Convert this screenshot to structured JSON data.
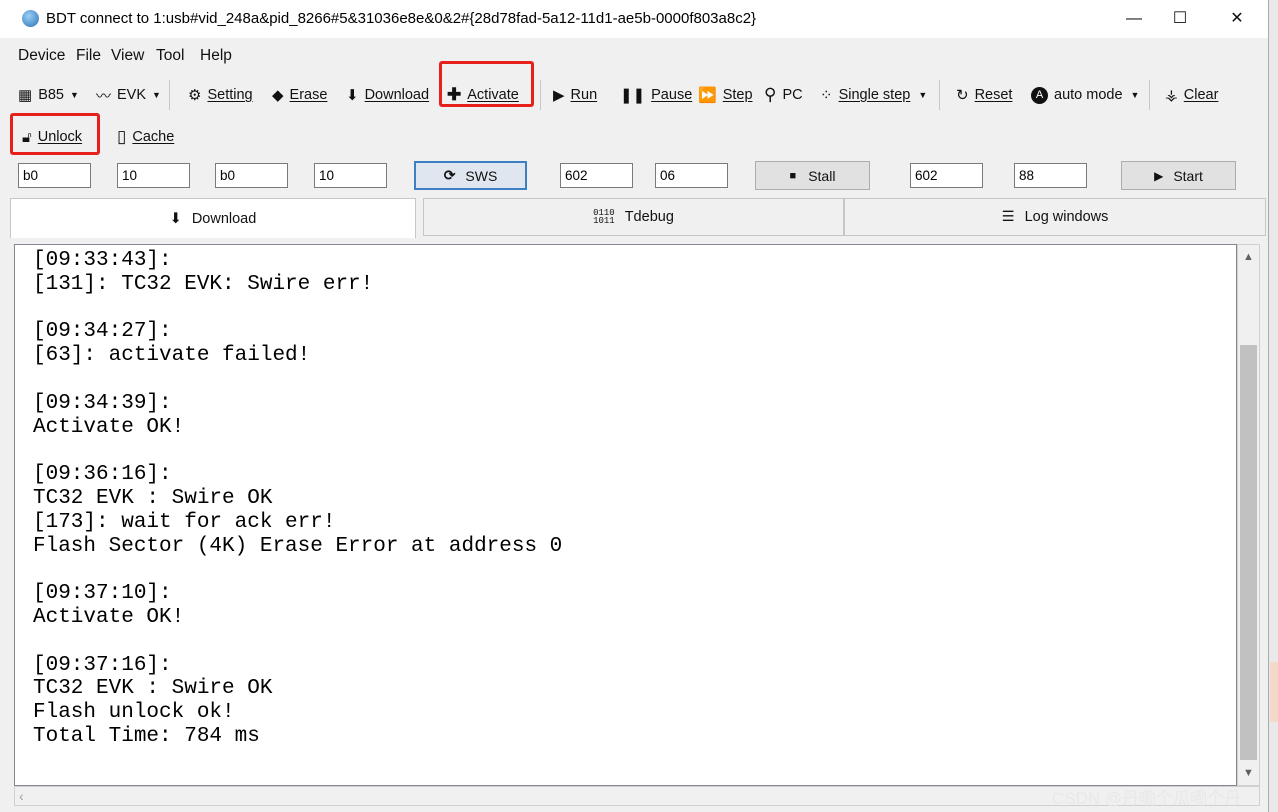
{
  "window": {
    "title": "BDT connect to 1:usb#vid_248a&pid_8266#5&31036e8e&0&2#{28d78fad-5a12-11d1-ae5b-0000f803a8c2}",
    "controls": {
      "minimize": "—",
      "maximize": "☐",
      "close": "✕"
    }
  },
  "menu": [
    "Device",
    "File",
    "View",
    "Tool",
    "Help"
  ],
  "toolbar": {
    "chip": "B85",
    "board": "EVK",
    "setting": "Setting",
    "erase": "Erase",
    "download": "Download",
    "activate": "Activate",
    "run": "Run",
    "pause": "Pause",
    "step": "Step",
    "pc": "PC",
    "single_step": "Single step",
    "reset": "Reset",
    "auto_mode": "auto mode",
    "clear": "Clear"
  },
  "toolbar2": {
    "unlock": "Unlock",
    "cache": "Cache"
  },
  "inputs": {
    "f1": "b0",
    "f2": "10",
    "f3": "b0",
    "f4": "10",
    "sws": "SWS",
    "f5": "602",
    "f6": "06",
    "stall": "Stall",
    "f7": "602",
    "f8": "88",
    "start": "Start"
  },
  "tabs": [
    "Download",
    "Tdebug",
    "Log windows"
  ],
  "log": "[09:33:43]:\n[131]: TC32 EVK: Swire err!\n\n[09:34:27]:\n[63]: activate failed!\n\n[09:34:39]:\nActivate OK!\n\n[09:36:16]:\nTC32 EVK : Swire OK\n[173]: wait for ack err!\nFlash Sector (4K) Erase Error at address 0\n\n[09:37:10]:\nActivate OK!\n\n[09:37:16]:\nTC32 EVK : Swire OK\nFlash unlock ok!\nTotal Time: 784 ms",
  "watermark": "CSDN @丹嘞个瓜嘞个丹",
  "colors": {
    "highlight": "#e8201c",
    "selected_button": "#3c7fc2"
  }
}
